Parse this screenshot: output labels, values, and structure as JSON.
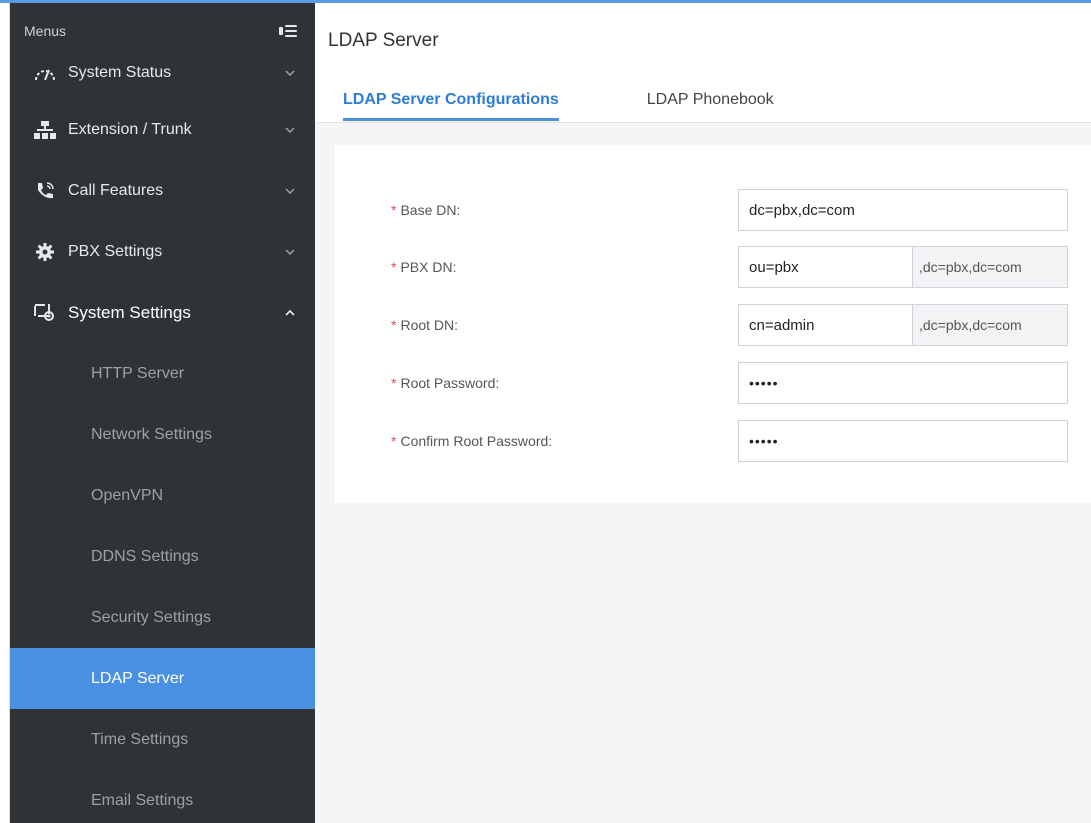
{
  "sidebar": {
    "header": "Menus",
    "items": [
      {
        "label": "System Status",
        "icon": "speedometer-icon"
      },
      {
        "label": "Extension / Trunk",
        "icon": "network-icon"
      },
      {
        "label": "Call Features",
        "icon": "phone-call-icon"
      },
      {
        "label": "PBX Settings",
        "icon": "gear-icon"
      },
      {
        "label": "System Settings",
        "icon": "monitor-gear-icon"
      }
    ],
    "submenu": [
      "HTTP Server",
      "Network Settings",
      "OpenVPN",
      "DDNS Settings",
      "Security Settings",
      "LDAP Server",
      "Time Settings",
      "Email Settings"
    ],
    "active_submenu": "LDAP Server"
  },
  "page": {
    "title": "LDAP Server",
    "tabs": [
      "LDAP Server Configurations",
      "LDAP Phonebook"
    ],
    "active_tab": 0
  },
  "form": {
    "required_mark": "*",
    "fields": [
      {
        "label": "Base DN:",
        "value": "dc=pbx,dc=com"
      },
      {
        "label": "PBX DN:",
        "value": "ou=pbx",
        "suffix": ",dc=pbx,dc=com"
      },
      {
        "label": "Root DN:",
        "value": "cn=admin",
        "suffix": ",dc=pbx,dc=com"
      },
      {
        "label": "Root Password:",
        "value": "•••••"
      },
      {
        "label": "Confirm Root Password:",
        "value": "•••••"
      }
    ]
  },
  "colors": {
    "sidebar_bg": "#2f3337",
    "accent": "#4a90e2",
    "required": "#e04b4b"
  }
}
